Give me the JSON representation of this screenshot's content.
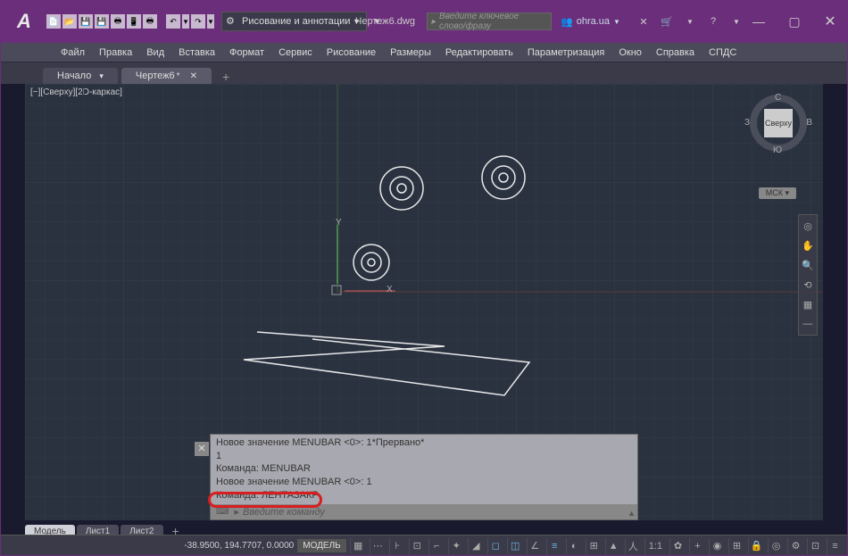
{
  "logo": "A",
  "mode": {
    "label": "Рисование и аннотации",
    "dd": "▼"
  },
  "doc_name": "Чертеж6.dwg",
  "search_placeholder": "Введите ключевое слово/фразу",
  "user": {
    "name": "ohra.ua"
  },
  "menubar": [
    "Файл",
    "Правка",
    "Вид",
    "Вставка",
    "Формат",
    "Сервис",
    "Рисование",
    "Размеры",
    "Редактировать",
    "Параметризация",
    "Окно",
    "Справка",
    "СПДС"
  ],
  "tabs": [
    {
      "label": "Начало",
      "dd": "▾",
      "active": false
    },
    {
      "label": "Чертеж6",
      "star": "*",
      "active": true
    }
  ],
  "view_label": "[−][Сверху][2D-каркас]",
  "ucs": {
    "x": "X",
    "y": "Y"
  },
  "viewcube": {
    "face": "Сверху",
    "n": "С",
    "s": "Ю",
    "e": "В",
    "w": "З"
  },
  "wcs": "МСК ▾",
  "cmd": {
    "lines": [
      "Новое значение MENUBAR <0>: 1*Прервано*",
      "1",
      "Команда: MENUBAR",
      "Новое значение MENUBAR <0>: 1",
      "Команда: ЛЕНТАЗАКР"
    ],
    "input_placeholder": "Введите команду"
  },
  "layout_tabs": [
    "Модель",
    "Лист1",
    "Лист2"
  ],
  "status": {
    "coords": "-38.9500, 194.7707, 0.0000",
    "mode": "МОДЕЛЬ",
    "scale": "1:1"
  }
}
